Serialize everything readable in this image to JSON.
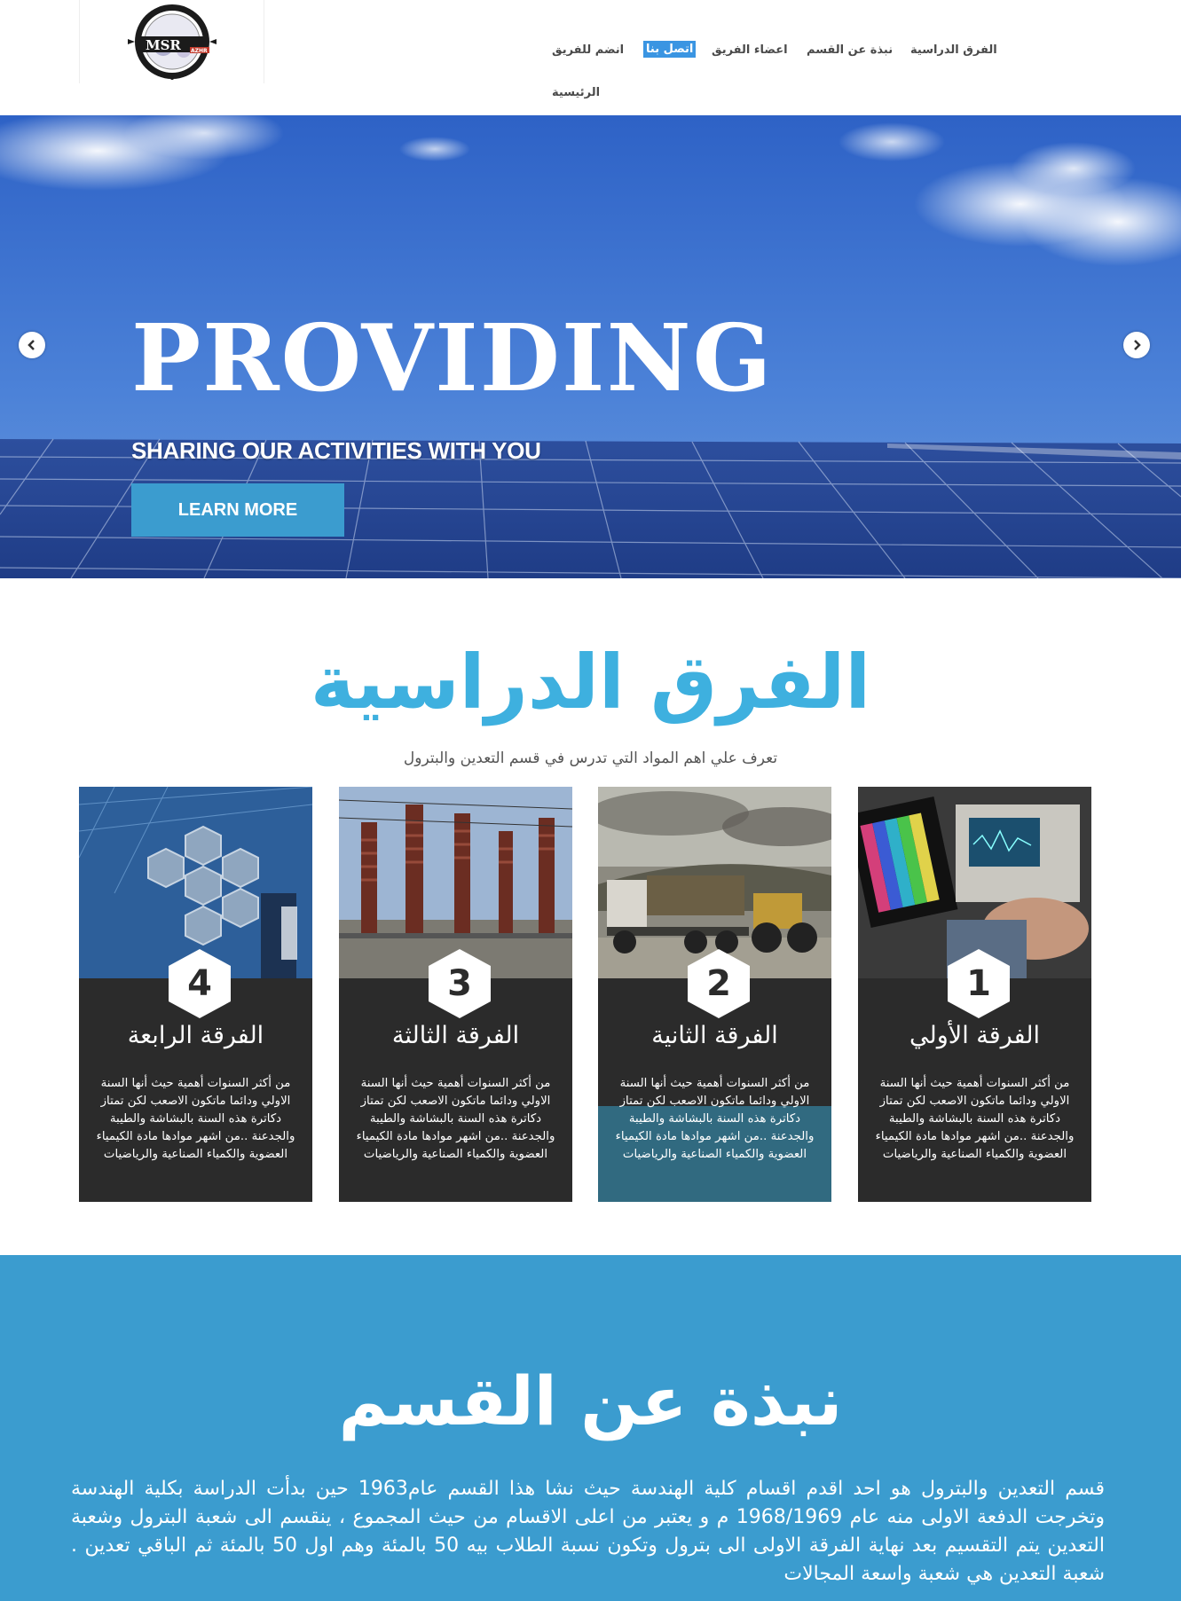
{
  "header": {
    "logo": {
      "main": "MSR",
      "sub": "AZHR",
      "ring_text": "MINING & SCIENTIFIC RESEARCH",
      "bottom_text": "ALAZHR UNIVERSITY"
    },
    "nav": [
      {
        "label": "الفرق الدراسية"
      },
      {
        "label": "نبذة عن القسم"
      },
      {
        "label": "اعضاء الفريق"
      },
      {
        "label": "اتصل بنا",
        "active": true
      },
      {
        "label": "انضم للفريق"
      },
      {
        "label": "الرئيسية"
      }
    ]
  },
  "hero": {
    "title": "PROVIDING",
    "subtitle": "SHARING OUR ACTIVITIES WITH YOU",
    "button": "LEARN MORE"
  },
  "years": {
    "title": "الفرق الدراسية",
    "subtitle": "تعرف علي اهم المواد التي تدرس في قسم التعدين والبترول",
    "cards": [
      {
        "number": "4",
        "title": "الفرقة الرابعة",
        "text": "من أكثر السنوات أهمية حيث أنها السنة الاولي ودائما ماتكون الاصعب لكن تمتاز دكاترة هذه السنة بالبشاشة والطيبة والجدعنة ..من اشهر موادها مادة الكيمياء العضوية والكمياء الصناعية والرياضيات"
      },
      {
        "number": "3",
        "title": "الفرقة الثالثة",
        "text": "من أكثر السنوات أهمية حيث أنها السنة الاولي ودائما ماتكون الاصعب لكن تمتاز دكاترة هذه السنة بالبشاشة والطيبة والجدعنة ..من اشهر موادها مادة الكيمياء العضوية والكمياء الصناعية والرياضيات"
      },
      {
        "number": "2",
        "title": "الفرقة الثانية",
        "text": "من أكثر السنوات أهمية حيث أنها السنة الاولي ودائما ماتكون الاصعب لكن تمتاز دكاترة هذه السنة بالبشاشة والطيبة والجدعنة ..من اشهر موادها مادة الكيمياء العضوية والكمياء الصناعية والرياضيات"
      },
      {
        "number": "1",
        "title": "الفرقة الأولي",
        "text": "من أكثر السنوات أهمية حيث أنها السنة الاولي ودائما ماتكون الاصعب لكن تمتاز دكاترة هذه السنة بالبشاشة والطيبة والجدعنة ..من اشهر موادها مادة الكيمياء العضوية والكمياء الصناعية والرياضيات"
      }
    ]
  },
  "about": {
    "title": "نبذة عن القسم",
    "text": "قسم التعدين والبترول هو احد اقدم اقسام كلية الهندسة حيث نشا هذا القسم عام1963 حين بدأت الدراسة بكلية الهندسة وتخرجت الدفعة الاولى منه عام 1968/1969 م و يعتبر من اعلى الاقسام من حيث المجموع ، ينقسم الى شعبة البترول وشعبة التعدين يتم التقسيم بعد نهاية الفرقة الاولى الى بترول وتكون نسبة الطلاب بيه 50 بالمئة وهم اول 50 بالمئة ثم الباقي تعدين . شعبة التعدين هي شعبة واسعة المجالات"
  },
  "colors": {
    "accent": "#3eb0df",
    "nav_active": "#3a95e2",
    "card_bg": "#2b2b2b",
    "about_bg": "#3b9ccf",
    "button": "#3b9ccf"
  }
}
